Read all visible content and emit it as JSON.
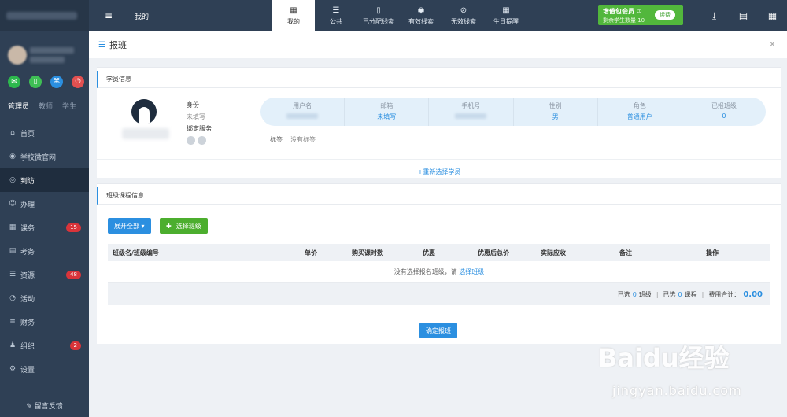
{
  "sidebar": {
    "roles": [
      "管理员",
      "教师",
      "学生"
    ],
    "items": [
      {
        "icon": "home-icon",
        "glyph": "⌂",
        "label": "首页",
        "badge": ""
      },
      {
        "icon": "globe-icon",
        "glyph": "◉",
        "label": "学校微官网",
        "badge": ""
      },
      {
        "icon": "eye-icon",
        "glyph": "◎",
        "label": "到访",
        "badge": ""
      },
      {
        "icon": "users-icon",
        "glyph": "☺",
        "label": "办理",
        "badge": ""
      },
      {
        "icon": "calendar-icon",
        "glyph": "▦",
        "label": "课务",
        "badge": "15"
      },
      {
        "icon": "card-icon",
        "glyph": "▤",
        "label": "考务",
        "badge": ""
      },
      {
        "icon": "list-icon",
        "glyph": "☰",
        "label": "资源",
        "badge": "48"
      },
      {
        "icon": "activity-icon",
        "glyph": "◔",
        "label": "活动",
        "badge": ""
      },
      {
        "icon": "database-icon",
        "glyph": "≡",
        "label": "财务",
        "badge": ""
      },
      {
        "icon": "graduation-icon",
        "glyph": "♟",
        "label": "组织",
        "badge": "2"
      },
      {
        "icon": "gear-icon",
        "glyph": "⚙",
        "label": "设置",
        "badge": ""
      }
    ],
    "feedback": "留言反馈"
  },
  "topbar": {
    "title": "我的",
    "tabs": [
      {
        "icon": "calendar-icon",
        "glyph": "▦",
        "label": "我的"
      },
      {
        "icon": "list-icon",
        "glyph": "☰",
        "label": "公共"
      },
      {
        "icon": "phone-icon",
        "glyph": "▯",
        "label": "已分配线索"
      },
      {
        "icon": "eye-icon",
        "glyph": "◉",
        "label": "有效线索"
      },
      {
        "icon": "eye-slash-icon",
        "glyph": "⊘",
        "label": "无效线索"
      },
      {
        "icon": "calendar-grid-icon",
        "glyph": "▦",
        "label": "生日提醒"
      }
    ],
    "vip": {
      "title": "增值包会员 ♔",
      "sub": "剩余学生数量 10",
      "button": "续费"
    }
  },
  "page": {
    "title": "报班"
  },
  "student_card": {
    "title": "学员信息",
    "fields": {
      "identity": "身份",
      "identity_value": "未填写",
      "bind": "绑定服务"
    },
    "stats": [
      {
        "label": "用户名",
        "value": ""
      },
      {
        "label": "邮箱",
        "value": "未填写"
      },
      {
        "label": "手机号",
        "value": ""
      },
      {
        "label": "性别",
        "value": "男"
      },
      {
        "label": "角色",
        "value": "普通用户"
      },
      {
        "label": "已报班级",
        "value": "0"
      }
    ],
    "tags_label": "标签",
    "tags_value": "没有标签",
    "reselect": "+重新选择学员"
  },
  "class_card": {
    "title": "班级课程信息",
    "expand_button": "展开全部 ▾",
    "select_button": "选择班级",
    "columns": [
      "班级名/班级编号",
      "单价",
      "购买课时数",
      "优惠",
      "优惠后总价",
      "实际应收",
      "备注",
      "操作"
    ],
    "empty_text": "没有选择报名班级，请",
    "empty_link": "选择班级",
    "footer": {
      "selected_label": "已选",
      "class_count": "0",
      "class_unit": "班级",
      "course_count": "0",
      "course_unit": "课程",
      "total_label": "费用合计：",
      "total": "0.00"
    },
    "confirm": "确定报班"
  },
  "watermark": {
    "main": "Baidu经验",
    "sub": "jingyan.baidu.com"
  }
}
